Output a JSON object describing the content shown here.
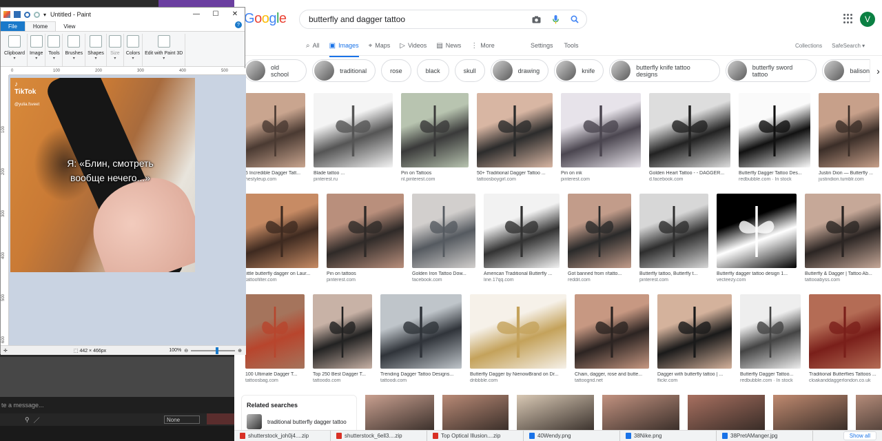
{
  "paint": {
    "title": "Untitled - Paint",
    "menu": [
      "File",
      "Home",
      "View"
    ],
    "help": "?",
    "ribbon": [
      {
        "label": "Clipboard",
        "icon": "clipboard-icon"
      },
      {
        "label": "Image",
        "icon": "image-icon"
      },
      {
        "label": "Tools",
        "icon": "tools-icon"
      },
      {
        "label": "Brushes",
        "icon": "brush-icon"
      },
      {
        "label": "Shapes",
        "icon": "shapes-icon"
      },
      {
        "label": "Size",
        "icon": "size-icon"
      },
      {
        "label": "Colors",
        "icon": "colors-icon"
      },
      {
        "label": "Edit with Paint 3D",
        "icon": "paint3d-icon"
      }
    ],
    "ruler_h": [
      "0",
      "100",
      "200",
      "300",
      "400",
      "500"
    ],
    "ruler_v": [
      "100",
      "200",
      "300",
      "400",
      "500",
      "600"
    ],
    "image": {
      "tiktok": "TikTok",
      "user": "@yulia.fsveet",
      "caption_1": "Я: «Блин, смотреть",
      "caption_2": "вообще нечего...»"
    },
    "status": {
      "size": "442 × 466px",
      "zoom": "100%"
    }
  },
  "background_app": {
    "message_placeholder": "te a message...",
    "select_value": "None"
  },
  "google": {
    "logo": "Google",
    "query": "butterfly and dagger tattoo",
    "avatar": "V",
    "tabs": [
      {
        "label": "All",
        "icon": "search-icon"
      },
      {
        "label": "Images",
        "icon": "image-icon",
        "active": true
      },
      {
        "label": "Maps",
        "icon": "map-pin-icon"
      },
      {
        "label": "Videos",
        "icon": "video-icon"
      },
      {
        "label": "News",
        "icon": "news-icon"
      },
      {
        "label": "More",
        "icon": "more-icon"
      }
    ],
    "settings": "Settings",
    "tools": "Tools",
    "collections": "Collections",
    "safesearch": "SafeSearch",
    "chips": [
      {
        "label": "old school",
        "thumb": true
      },
      {
        "label": "traditional",
        "thumb": true
      },
      {
        "label": "rose",
        "thumb": false
      },
      {
        "label": "black",
        "thumb": false
      },
      {
        "label": "skull",
        "thumb": false
      },
      {
        "label": "drawing",
        "thumb": true
      },
      {
        "label": "knife",
        "thumb": true
      },
      {
        "label": "butterfly knife tattoo designs",
        "thumb": true
      },
      {
        "label": "butterfly sword tattoo",
        "thumb": true
      },
      {
        "label": "balisong",
        "thumb": true
      }
    ],
    "rows": [
      [
        {
          "title": "5 Incredible Dagger Tatt...",
          "source": "hestyleup.com",
          "c1": "#c9a58f",
          "c2": "#4a3a32"
        },
        {
          "title": "Blade tattoo ...",
          "source": "pinterest.ru",
          "c1": "#f4f4f4",
          "c2": "#555555"
        },
        {
          "title": "Pin on Tattoos",
          "source": "nl.pinterest.com",
          "c1": "#b8c4b0",
          "c2": "#3a3a3a"
        },
        {
          "title": "50+ Traditional Dagger Tattoo ...",
          "source": "tattoosboygirl.com",
          "c1": "#d8b6a3",
          "c2": "#2c2c2c"
        },
        {
          "title": "Pin on ink",
          "source": "pinterest.com",
          "c1": "#e7e3ea",
          "c2": "#4b4650"
        },
        {
          "title": "Golden Heart Tattoo - - DAGGER...",
          "source": "d.facebook.com",
          "c1": "#dddddd",
          "c2": "#222222"
        },
        {
          "title": "Butterfly Dagger Tattoo Des...",
          "source": "redbubble.com · In stock",
          "c1": "#fafafa",
          "c2": "#111111"
        },
        {
          "title": "Justin Dion — Butterfly ...",
          "source": "justindion.tumblr.com",
          "c1": "#c7a08a",
          "c2": "#3b2e28"
        }
      ],
      [
        {
          "title": "little butterfly dagger on Laur...",
          "source": "tattoofilter.com",
          "c1": "#c78b64",
          "c2": "#3e2a20"
        },
        {
          "title": "Pin on tattoos",
          "source": "pinterest.com",
          "c1": "#b98f7c",
          "c2": "#2f2a28"
        },
        {
          "title": "Golden Iron Tattoo Dow...",
          "source": "facebook.com",
          "c1": "#d2cfcd",
          "c2": "#555a60"
        },
        {
          "title": "American Traditional Butterfly ...",
          "source": "line.17qq.com",
          "c1": "#f2f2f2",
          "c2": "#333333"
        },
        {
          "title": "Got banned from r/tatto...",
          "source": "reddit.com",
          "c1": "#c29c8a",
          "c2": "#2a2a2a"
        },
        {
          "title": "Butterfly tattoo, Butterfly t...",
          "source": "pinterest.com",
          "c1": "#d7d7d7",
          "c2": "#2e2e2e"
        },
        {
          "title": "Butterfly dagger tattoo design 1...",
          "source": "vecteezy.com",
          "c1": "#000000",
          "c2": "#ffffff"
        },
        {
          "title": "Butterfly & Dagger | Tattoo Ab...",
          "source": "tattooabyss.com",
          "c1": "#c6a898",
          "c2": "#2b2523"
        }
      ],
      [
        {
          "title": "100 Ultimate Dagger T...",
          "source": "tattoosbag.com",
          "c1": "#a5745c",
          "c2": "#b8452d"
        },
        {
          "title": "Top 250 Best Dagger T...",
          "source": "tattoodo.com",
          "c1": "#c8b2a6",
          "c2": "#222222"
        },
        {
          "title": "Trending Dagger Tattoo Designs...",
          "source": "tattoodi.com",
          "c1": "#bfc5ca",
          "c2": "#30343a"
        },
        {
          "title": "Butterfly Dagger by NienowBrand on Dr...",
          "source": "dribbble.com",
          "c1": "#f6f1e9",
          "c2": "#c4a25b"
        },
        {
          "title": "Chain, dagger, rose and butte...",
          "source": "tattoogrid.net",
          "c1": "#c79882",
          "c2": "#2c2422"
        },
        {
          "title": "Dagger with butterfly tattoo | ...",
          "source": "flickr.com",
          "c1": "#d4b29c",
          "c2": "#1a1a1a"
        },
        {
          "title": "Butterfly Dagger Tattoo...",
          "source": "redbubble.com · In stock",
          "c1": "#eeeeee",
          "c2": "#444444"
        },
        {
          "title": "Traditional Butterflies Tattoos ...",
          "source": "cloakanddaggerlondon.co.uk",
          "c1": "#b46c55",
          "c2": "#7a1f1a"
        }
      ]
    ],
    "related": {
      "heading": "Related searches",
      "item": "traditional butterfly dagger tattoo"
    }
  },
  "downloads": {
    "items": [
      {
        "label": "shutterstock_joh0j4....zip",
        "icon": "zip-file-icon"
      },
      {
        "label": "shutterstock_6ell3....zip",
        "icon": "zip-file-icon"
      },
      {
        "label": "Top Optical Illusion....zip",
        "icon": "zip-file-icon"
      },
      {
        "label": "40Wendy.png",
        "icon": "image-file-icon"
      },
      {
        "label": "38Nike.png",
        "icon": "image-file-icon"
      },
      {
        "label": "38PretAManger.jpg",
        "icon": "image-file-icon"
      }
    ],
    "show_all": "Show all"
  }
}
